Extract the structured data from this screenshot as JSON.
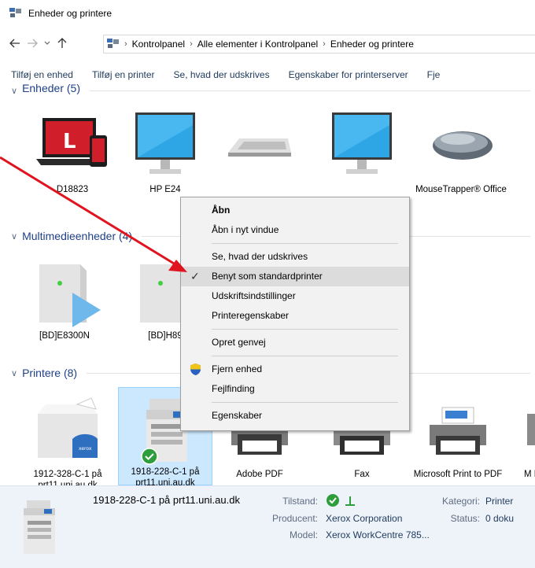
{
  "window": {
    "title": "Enheder og printere"
  },
  "breadcrumb": [
    "Kontrolpanel",
    "Alle elementer i Kontrolpanel",
    "Enheder og printere"
  ],
  "toolbar": {
    "items": [
      "Tilføj en enhed",
      "Tilføj en printer",
      "Se, hvad der udskrives",
      "Egenskaber for printerserver",
      "Fje"
    ]
  },
  "groups": {
    "devices": "Enheder (5)",
    "multimedia": "Multimedieenheder (4)",
    "printers": "Printere (8)"
  },
  "devices": [
    {
      "name": "D18823",
      "icon": "laptop-phone-icon"
    },
    {
      "name": "HP E24",
      "icon": "monitor-icon"
    },
    {
      "name": "",
      "icon": "keyboard-icon"
    },
    {
      "name": "",
      "icon": "monitor-icon"
    },
    {
      "name": "MouseTrapper® Office",
      "icon": "mouse-icon"
    }
  ],
  "multimedia": [
    {
      "name": "[BD]E8300N",
      "icon": "media-server-icon"
    },
    {
      "name": "[BD]H89",
      "icon": "media-server-icon"
    }
  ],
  "printers": [
    {
      "name": "1912-328-C-1 på prt11.uni.au.dk",
      "icon": "printer-icon"
    },
    {
      "name": "1918-228-C-1 på prt11.uni.au.dk",
      "icon": "multifunction-printer-icon",
      "selected": true
    },
    {
      "name": "Adobe PDF",
      "icon": "printer-icon"
    },
    {
      "name": "Fax",
      "icon": "fax-icon"
    },
    {
      "name": "Microsoft Print to PDF",
      "icon": "printer-icon"
    },
    {
      "name": "M Do",
      "icon": "printer-icon"
    }
  ],
  "context_menu": {
    "open": "Åbn",
    "open_new_window": "Åbn i nyt vindue",
    "see_printing": "Se, hvad der udskrives",
    "set_default": "Benyt som standardprinter",
    "print_settings": "Udskriftsindstillinger",
    "printer_properties": "Printeregenskaber",
    "create_shortcut": "Opret genvej",
    "remove_device": "Fjern enhed",
    "troubleshoot": "Fejlfinding",
    "properties": "Egenskaber"
  },
  "details": {
    "name": "1918-228-C-1 på prt11.uni.au.dk",
    "state_label": "Tilstand:",
    "manufacturer_label": "Producent:",
    "manufacturer": "Xerox Corporation",
    "model_label": "Model:",
    "model": "Xerox WorkCentre 785...",
    "category_label": "Kategori:",
    "category": "Printer",
    "status_label": "Status:",
    "status": "0 doku"
  },
  "colors": {
    "arrow": "#e0141e",
    "selection": "#cce8ff",
    "accent": "#1e3f8a"
  }
}
